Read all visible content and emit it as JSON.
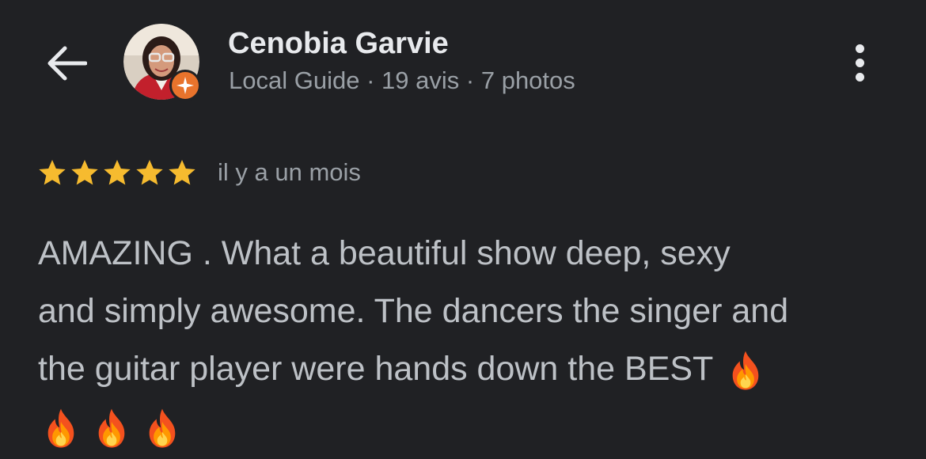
{
  "header": {
    "back_icon": "arrow-left-icon",
    "more_icon": "more-vertical-icon"
  },
  "reviewer": {
    "name": "Cenobia Garvie",
    "role": "Local Guide",
    "separator": "·",
    "reviews": "19 avis",
    "photos": "7 photos",
    "badge_icon": "local-guide-star-icon",
    "badge_color": "#e8732c"
  },
  "review": {
    "rating": 5,
    "max_rating": 5,
    "star_color": "#f6bb2f",
    "date": "il y a un mois",
    "text_lines": [
      "AMAZING . What a beautiful show deep, sexy",
      "and simply awesome. The dancers the singer and",
      "the guitar player were hands down the BEST "
    ],
    "emoji_icon": "fire-emoji-icon"
  },
  "colors": {
    "background": "#202124",
    "name": "#e8eaed",
    "meta": "#9aa0a6",
    "body_text": "#bdc1c6"
  }
}
